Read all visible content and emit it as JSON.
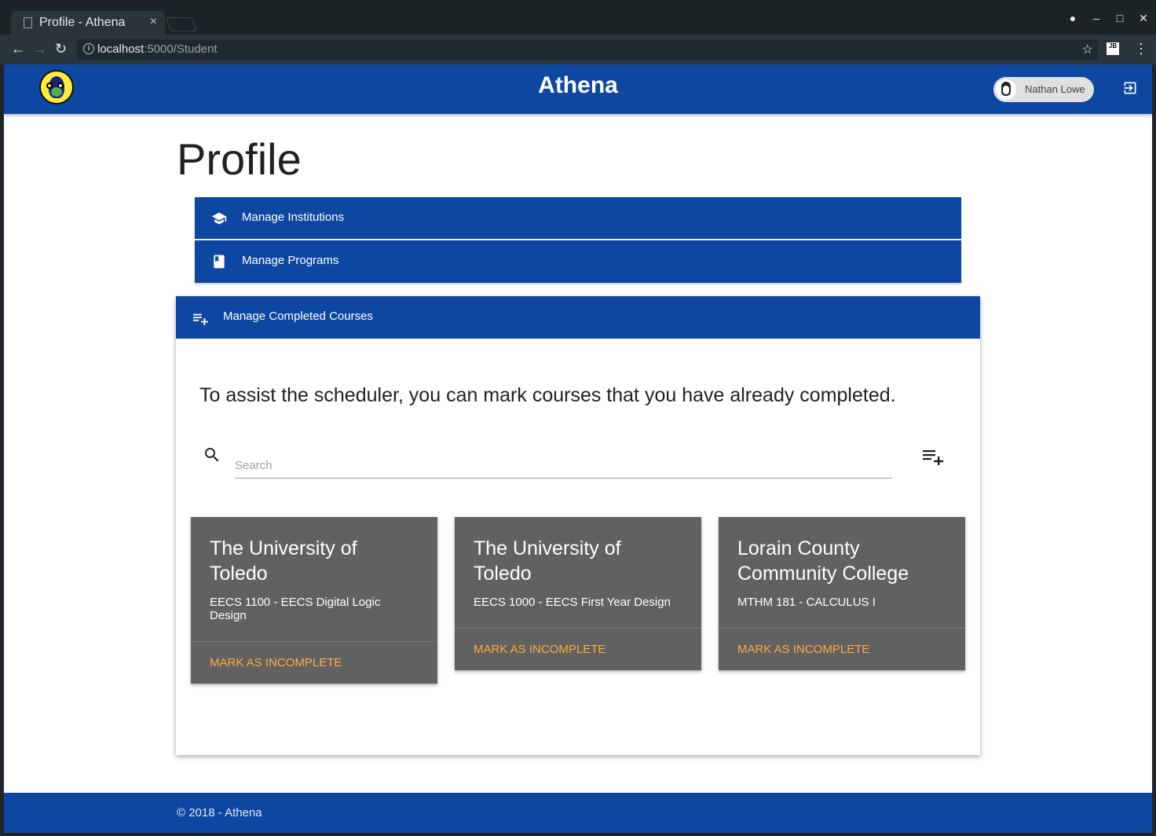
{
  "browser": {
    "tab_title": "Profile - Athena",
    "tab_close": "×",
    "url_host": "localhost",
    "url_rest": ":5000/Student",
    "window_controls": [
      "–",
      "□",
      "✕"
    ]
  },
  "appbar": {
    "title": "Athena",
    "user_name": "Nathan Lowe"
  },
  "page": {
    "title": "Profile"
  },
  "menu": [
    {
      "label": "Manage Institutions",
      "icon": "school-icon"
    },
    {
      "label": "Manage Programs",
      "icon": "book-icon"
    }
  ],
  "completed_courses": {
    "header": "Manage Completed Courses",
    "intro": "To assist the scheduler, you can mark courses that you have already completed.",
    "search_placeholder": "Search",
    "cards": [
      {
        "institution": "The University of Toledo",
        "course": "EECS 1100 - EECS Digital Logic Design",
        "action": "Mark as incomplete"
      },
      {
        "institution": "The University of Toledo",
        "course": "EECS 1000 - EECS First Year Design",
        "action": "Mark as incomplete"
      },
      {
        "institution": "Lorain County Community College",
        "course": "MTHM 181 - CALCULUS I",
        "action": "Mark as incomplete"
      }
    ]
  },
  "footer": {
    "text": "© 2018 - Athena"
  },
  "colors": {
    "primary": "#0d47a1",
    "card": "#616161",
    "accent": "#ffab40"
  }
}
